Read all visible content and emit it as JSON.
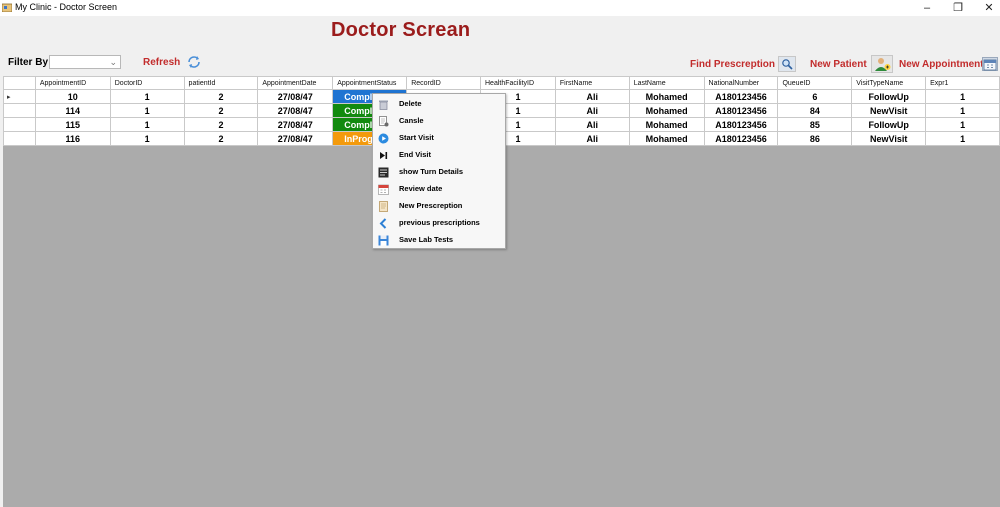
{
  "window": {
    "title": "My Clinic - Doctor Screen",
    "min": "–",
    "max": "❐",
    "close": "✕"
  },
  "header": {
    "title": "Doctor Screan"
  },
  "toolbar": {
    "filter_label": "Filter By",
    "filter_value": "",
    "refresh_label": "Refresh",
    "find_prescription_label": "Find Prescreption",
    "new_patient_label": "New Patient",
    "new_appointment_label": "New Appointment"
  },
  "grid": {
    "columns": [
      "AppointmentID",
      "DoctorID",
      "patientId",
      "AppointmentDate",
      "AppointmentStatus",
      "RecordID",
      "HealthFacilityID",
      "FirstName",
      "LastName",
      "NationalNumber",
      "QueueID",
      "VisitTypeName",
      "Expr1"
    ],
    "rows": [
      {
        "marker": "▸",
        "cells": [
          "10",
          "1",
          "2",
          "27/08/47",
          "Compl",
          "",
          "1",
          "Ali",
          "Mohamed",
          "A180123456",
          "6",
          "FollowUp",
          "1"
        ]
      },
      {
        "marker": "",
        "cells": [
          "114",
          "1",
          "2",
          "27/08/47",
          "Compl",
          "",
          "1",
          "Ali",
          "Mohamed",
          "A180123456",
          "84",
          "NewVisit",
          "1"
        ]
      },
      {
        "marker": "",
        "cells": [
          "115",
          "1",
          "2",
          "27/08/47",
          "Compl",
          "",
          "1",
          "Ali",
          "Mohamed",
          "A180123456",
          "85",
          "FollowUp",
          "1"
        ]
      },
      {
        "marker": "",
        "cells": [
          "116",
          "1",
          "2",
          "27/08/47",
          "InProg",
          "",
          "1",
          "Ali",
          "Mohamed",
          "A180123456",
          "86",
          "NewVisit",
          "1"
        ]
      }
    ]
  },
  "context_menu": {
    "items": [
      {
        "label": "Delete",
        "icon": "trash-icon"
      },
      {
        "label": "Cansle",
        "icon": "cancel-doc-icon"
      },
      {
        "label": "Start Visit",
        "icon": "play-circle-icon"
      },
      {
        "label": "End Visit",
        "icon": "end-skip-icon"
      },
      {
        "label": "show Turn Details",
        "icon": "details-list-icon"
      },
      {
        "label": "Review date",
        "icon": "calendar-icon"
      },
      {
        "label": "New Prescreption",
        "icon": "prescription-doc-icon"
      },
      {
        "label": " previous prescriptions",
        "icon": "back-chevron-icon"
      },
      {
        "label": "Save Lab Tests",
        "icon": "save-disk-icon"
      }
    ]
  },
  "colors": {
    "title_red": "#9b1c1c",
    "label_red": "#c22c2c",
    "status_blue": "#1f74d2",
    "status_green": "#128a0f",
    "status_orange": "#f39a0c",
    "grid_background": "#ababab"
  }
}
